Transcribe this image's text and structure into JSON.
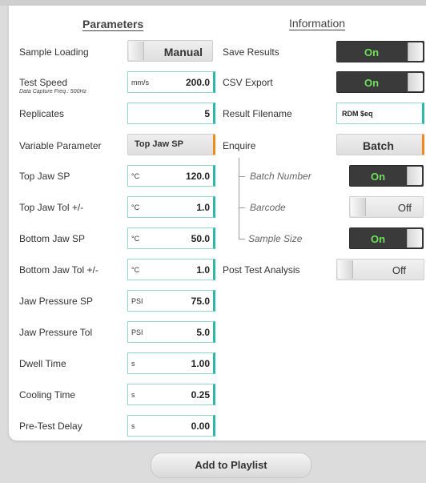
{
  "headings": {
    "parameters": "Parameters",
    "information": "Information"
  },
  "params": [
    {
      "label": "Sample Loading",
      "button": "Manual"
    },
    {
      "label": "Test Speed",
      "sublabel": "Data Capture Freq.: 500Hz",
      "unit": "mm/s",
      "value": "200.0"
    },
    {
      "label": "Replicates",
      "unit": "",
      "value": "5"
    },
    {
      "label": "Variable Parameter",
      "button": "Top Jaw SP"
    },
    {
      "label": "Top Jaw SP",
      "unit": "°C",
      "value": "120.0"
    },
    {
      "label": "Top Jaw Tol +/-",
      "unit": "°C",
      "value": "1.0"
    },
    {
      "label": "Bottom Jaw SP",
      "unit": "°C",
      "value": "50.0"
    },
    {
      "label": "Bottom Jaw Tol +/-",
      "unit": "°C",
      "value": "1.0"
    },
    {
      "label": "Jaw Pressure SP",
      "unit": "PSI",
      "value": "75.0"
    },
    {
      "label": "Jaw Pressure Tol",
      "unit": "PSI",
      "value": "5.0"
    },
    {
      "label": "Dwell Time",
      "unit": "s",
      "value": "1.00"
    },
    {
      "label": "Cooling Time",
      "unit": "s",
      "value": "0.25"
    },
    {
      "label": "Pre-Test Delay",
      "unit": "s",
      "value": "0.00"
    }
  ],
  "info": {
    "save_results": {
      "label": "Save Results",
      "state": "On"
    },
    "csv_export": {
      "label": "CSV Export",
      "state": "On"
    },
    "result_filename": {
      "label": "Result Filename",
      "value": "RDM $eq"
    },
    "enquire": {
      "label": "Enquire",
      "button": "Batch"
    },
    "batch_number": {
      "label": "Batch Number",
      "state": "On"
    },
    "barcode": {
      "label": "Barcode",
      "state": "Off"
    },
    "sample_size": {
      "label": "Sample Size",
      "state": "On"
    },
    "post_test": {
      "label": "Post Test Analysis",
      "state": "Off"
    }
  },
  "footer": {
    "add_label": "Add to Playlist"
  },
  "colors": {
    "accent_teal": "#2fb7aa",
    "accent_orange": "#f08a1a",
    "toggle_on_text": "#6ee05a",
    "toggle_dark": "#3a3a3a"
  }
}
